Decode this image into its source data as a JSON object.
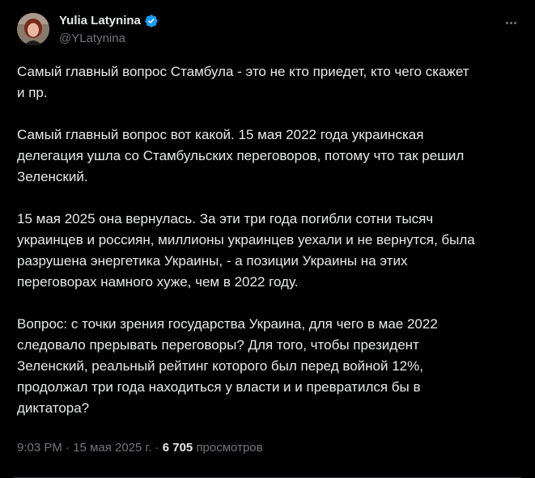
{
  "author": {
    "display_name": "Yulia Latynina",
    "handle": "@YLatynina",
    "verified_icon": "verified-badge-icon",
    "accent_color": "#1d9bf0"
  },
  "more_icon": "more-dots-icon",
  "tweet": {
    "paragraphs": [
      "Самый главный вопрос Стамбула - это не кто приедет,  кто чего скажет\nи пр.",
      "Самый главный вопрос вот какой. 15 мая 2022 года украинская\nделегация ушла со Стамбульских переговоров, потому что так решил\nЗеленский.",
      "15 мая 2025 она вернулась. За эти три года погибли сотни тысяч\nукраинцев и россиян, миллионы украинцев уехали и не вернутся, была\nразрушена энергетика Украины, - а позиции Украины на этих\nпереговорах намного хуже, чем в 2022 году.",
      "Вопрос: с точки зрения государства Украина, для чего в мае 2022\nследовало прерывать переговоры? Для того, чтобы президент\nЗеленский, реальный рейтинг которого был перед войной 12%,\nпродолжал три года находиться у власти и и превратился бы в\nдиктатора?"
    ]
  },
  "meta": {
    "time": "9:03 PM",
    "separator": "·",
    "date": "15 мая 2025 г.",
    "views_count": "6 705",
    "views_label": "просмотров"
  },
  "colors": {
    "background": "#000000",
    "text": "#e7e9ea",
    "secondary": "#71767b"
  }
}
